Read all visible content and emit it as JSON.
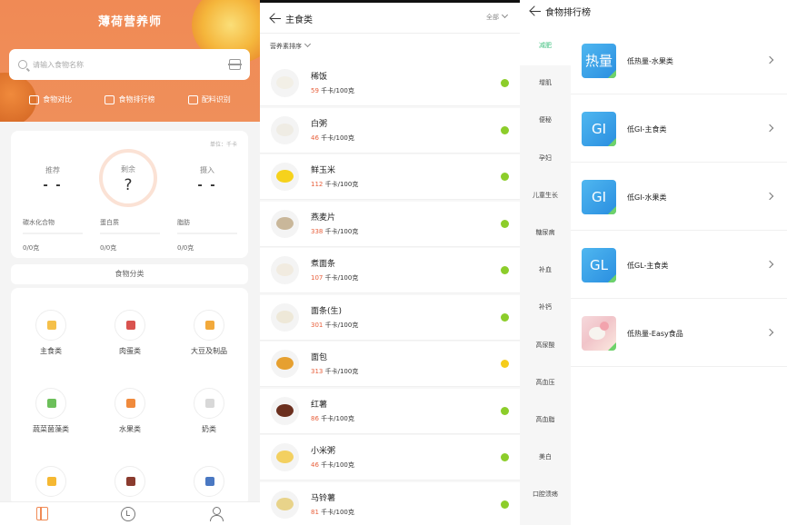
{
  "home": {
    "app_title": "薄荷营养师",
    "search_placeholder": "请输入食物名称",
    "quick_actions": [
      "食物对比",
      "食物排行榜",
      "配料识别"
    ],
    "unit_label": "单位：千卡",
    "recommend_label": "推荐",
    "recommend_value": "- -",
    "remaining_label": "剩余",
    "remaining_value": "?",
    "intake_label": "摄入",
    "intake_value": "- -",
    "macros": [
      {
        "label": "碳水化合物",
        "value": "0/0克"
      },
      {
        "label": "蛋白质",
        "value": "0/0克"
      },
      {
        "label": "脂肪",
        "value": "0/0克"
      }
    ],
    "category_title": "食物分类",
    "categories": [
      "主食类",
      "肉蛋类",
      "大豆及制品",
      "蔬菜菌藻类",
      "水果类",
      "奶类"
    ],
    "category_colors": [
      "#f5c04a",
      "#d9534f",
      "#f2a93b",
      "#6cbf5a",
      "#f08a3c",
      "#d8d8d8",
      "#f5b833",
      "#8a3b2e",
      "#4a78c2"
    ],
    "tabs": [
      "diary-icon",
      "record-icon",
      "profile-icon"
    ],
    "accent": "#f08a55"
  },
  "foods": {
    "title": "主食类",
    "filter": "全部",
    "sort": "营养素排序",
    "items": [
      {
        "name": "稀饭",
        "cal": "59",
        "unit": "千卡/100克",
        "status": "#8ccd2a",
        "img": "#f2efe6"
      },
      {
        "name": "白粥",
        "cal": "46",
        "unit": "千卡/100克",
        "status": "#8ccd2a",
        "img": "#efece4"
      },
      {
        "name": "鲜玉米",
        "cal": "112",
        "unit": "千卡/100克",
        "status": "#8ccd2a",
        "img": "#f6d21c"
      },
      {
        "name": "燕麦片",
        "cal": "338",
        "unit": "千卡/100克",
        "status": "#8ccd2a",
        "img": "#c9b79a"
      },
      {
        "name": "煮面条",
        "cal": "107",
        "unit": "千卡/100克",
        "status": "#8ccd2a",
        "img": "#f1ebe0"
      },
      {
        "name": "面条(生)",
        "cal": "301",
        "unit": "千卡/100克",
        "status": "#8ccd2a",
        "img": "#eee8d8"
      },
      {
        "name": "面包",
        "cal": "313",
        "unit": "千卡/100克",
        "status": "#f5cc1a",
        "img": "#e6a030"
      },
      {
        "name": "红薯",
        "cal": "86",
        "unit": "千卡/100克",
        "status": "#8ccd2a",
        "img": "#6b2f1e"
      },
      {
        "name": "小米粥",
        "cal": "46",
        "unit": "千卡/100克",
        "status": "#8ccd2a",
        "img": "#f3d060"
      },
      {
        "name": "马铃薯",
        "cal": "81",
        "unit": "千卡/100克",
        "status": "#8ccd2a",
        "img": "#e8d38a"
      }
    ]
  },
  "ranking": {
    "title": "食物排行榜",
    "sidebar": [
      "减肥",
      "增肌",
      "便秘",
      "孕妇",
      "儿童生长",
      "糖尿病",
      "补血",
      "补钙",
      "高尿酸",
      "高血压",
      "高血脂",
      "美白",
      "口腔溃疡"
    ],
    "active_index": 0,
    "active_color": "#3ec07e",
    "rows": [
      {
        "badge": "热量",
        "label": "低热量-水果类"
      },
      {
        "badge": "GI",
        "label": "低GI-主食类"
      },
      {
        "badge": "GI",
        "label": "低GI-水果类"
      },
      {
        "badge": "GL",
        "label": "低GL-主食类"
      },
      {
        "badge": "",
        "label": "低热量-Easy食品"
      }
    ]
  }
}
